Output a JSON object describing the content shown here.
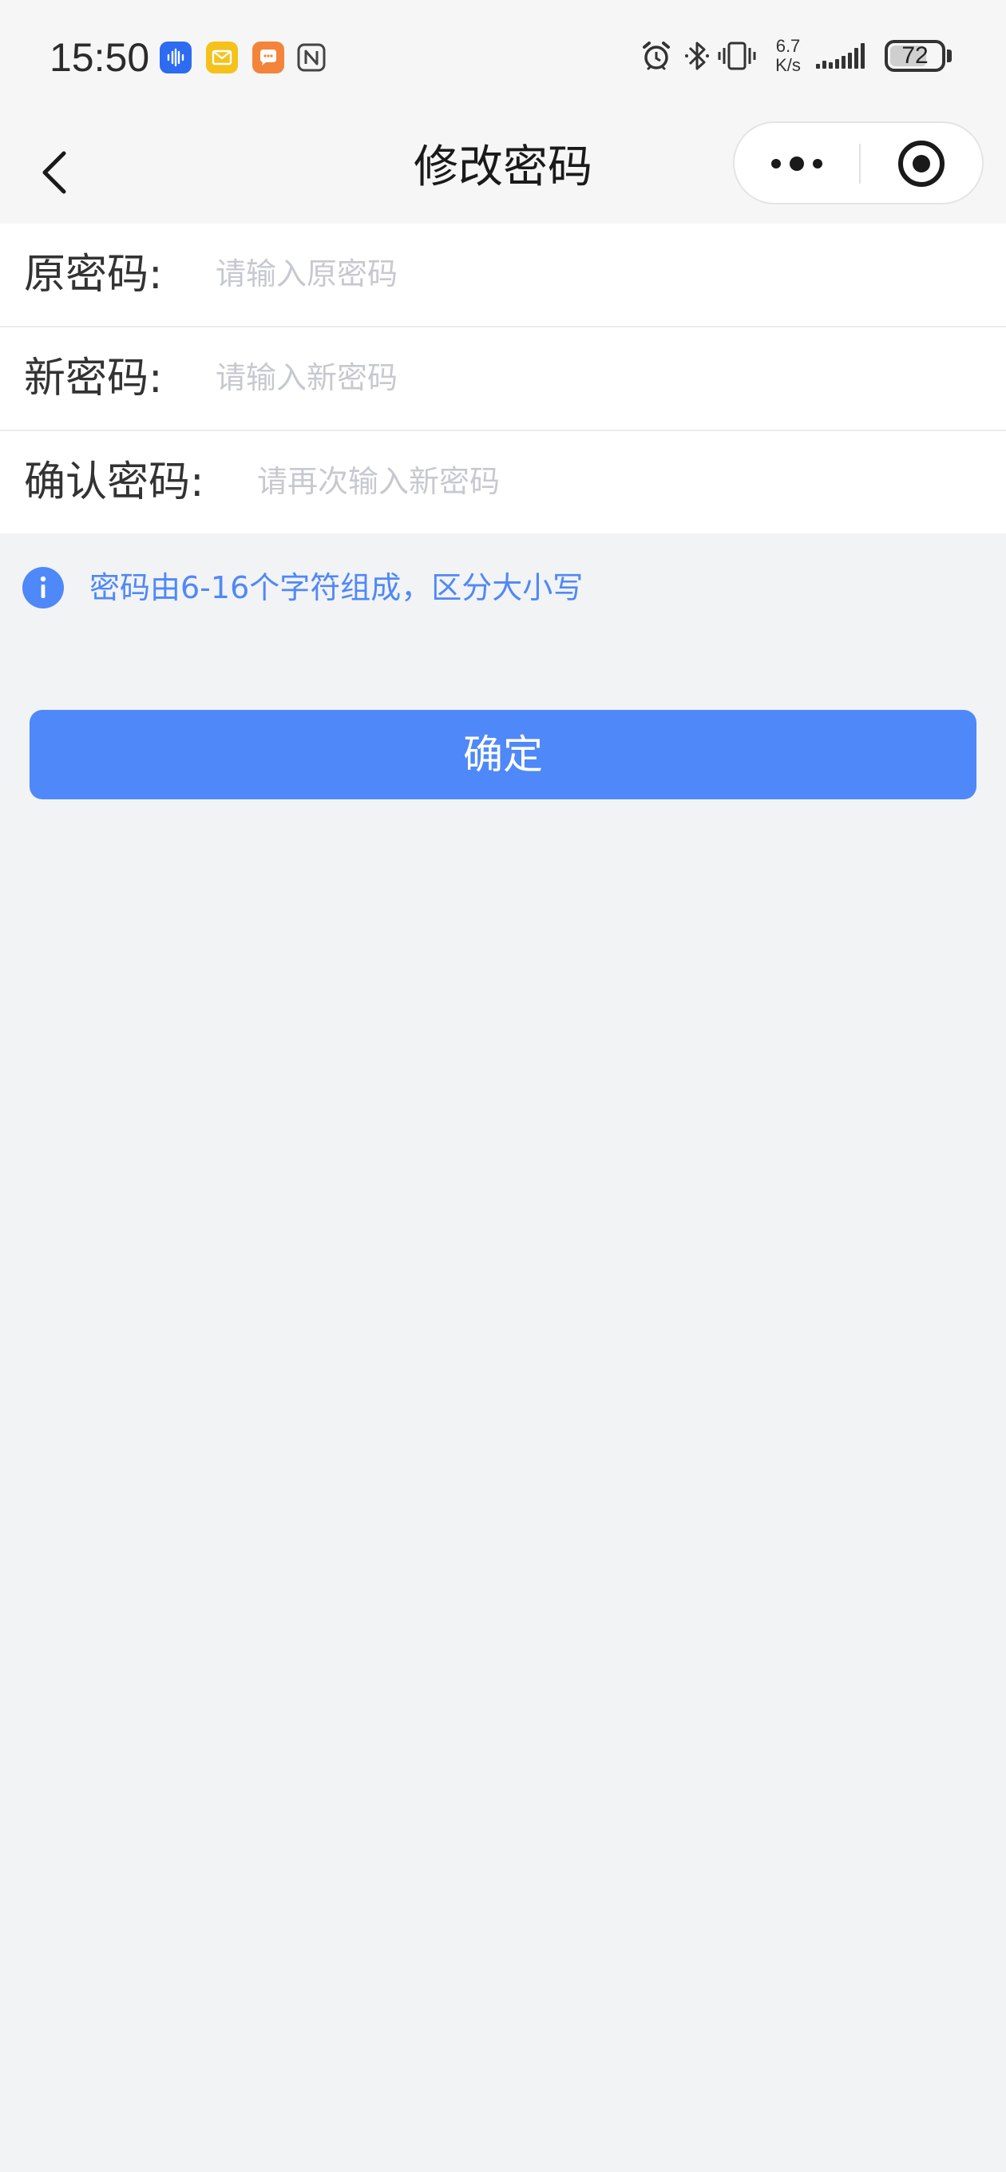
{
  "status_bar": {
    "time": "15:50",
    "net_speed_value": "6.7",
    "net_speed_unit": "K/s",
    "battery": "72",
    "battery_level": 0.72,
    "app_icons": [
      "voice-assistant-icon",
      "mail-icon",
      "chat-icon",
      "nfc-icon"
    ],
    "system_icons": [
      "alarm-icon",
      "bluetooth-icon",
      "vibrate-icon",
      "signal-icon"
    ]
  },
  "nav": {
    "title": "修改密码",
    "back_icon": "chevron-left-icon",
    "more_icon": "more-dots-icon",
    "close_icon": "target-close-icon"
  },
  "form": {
    "fields": [
      {
        "label": "原密码:",
        "placeholder": "请输入原密码",
        "value": ""
      },
      {
        "label": "新密码:",
        "placeholder": "请输入新密码",
        "value": ""
      },
      {
        "label": "确认密码:",
        "placeholder": "请再次输入新密码",
        "value": ""
      }
    ]
  },
  "hint": {
    "text": "密码由6-16个字符组成，区分大小写",
    "icon": "info-icon"
  },
  "confirm_button": {
    "label": "确定"
  },
  "colors": {
    "accent": "#4f88f8",
    "page_background": "#f2f3f5",
    "placeholder": "#c6c9cf"
  }
}
